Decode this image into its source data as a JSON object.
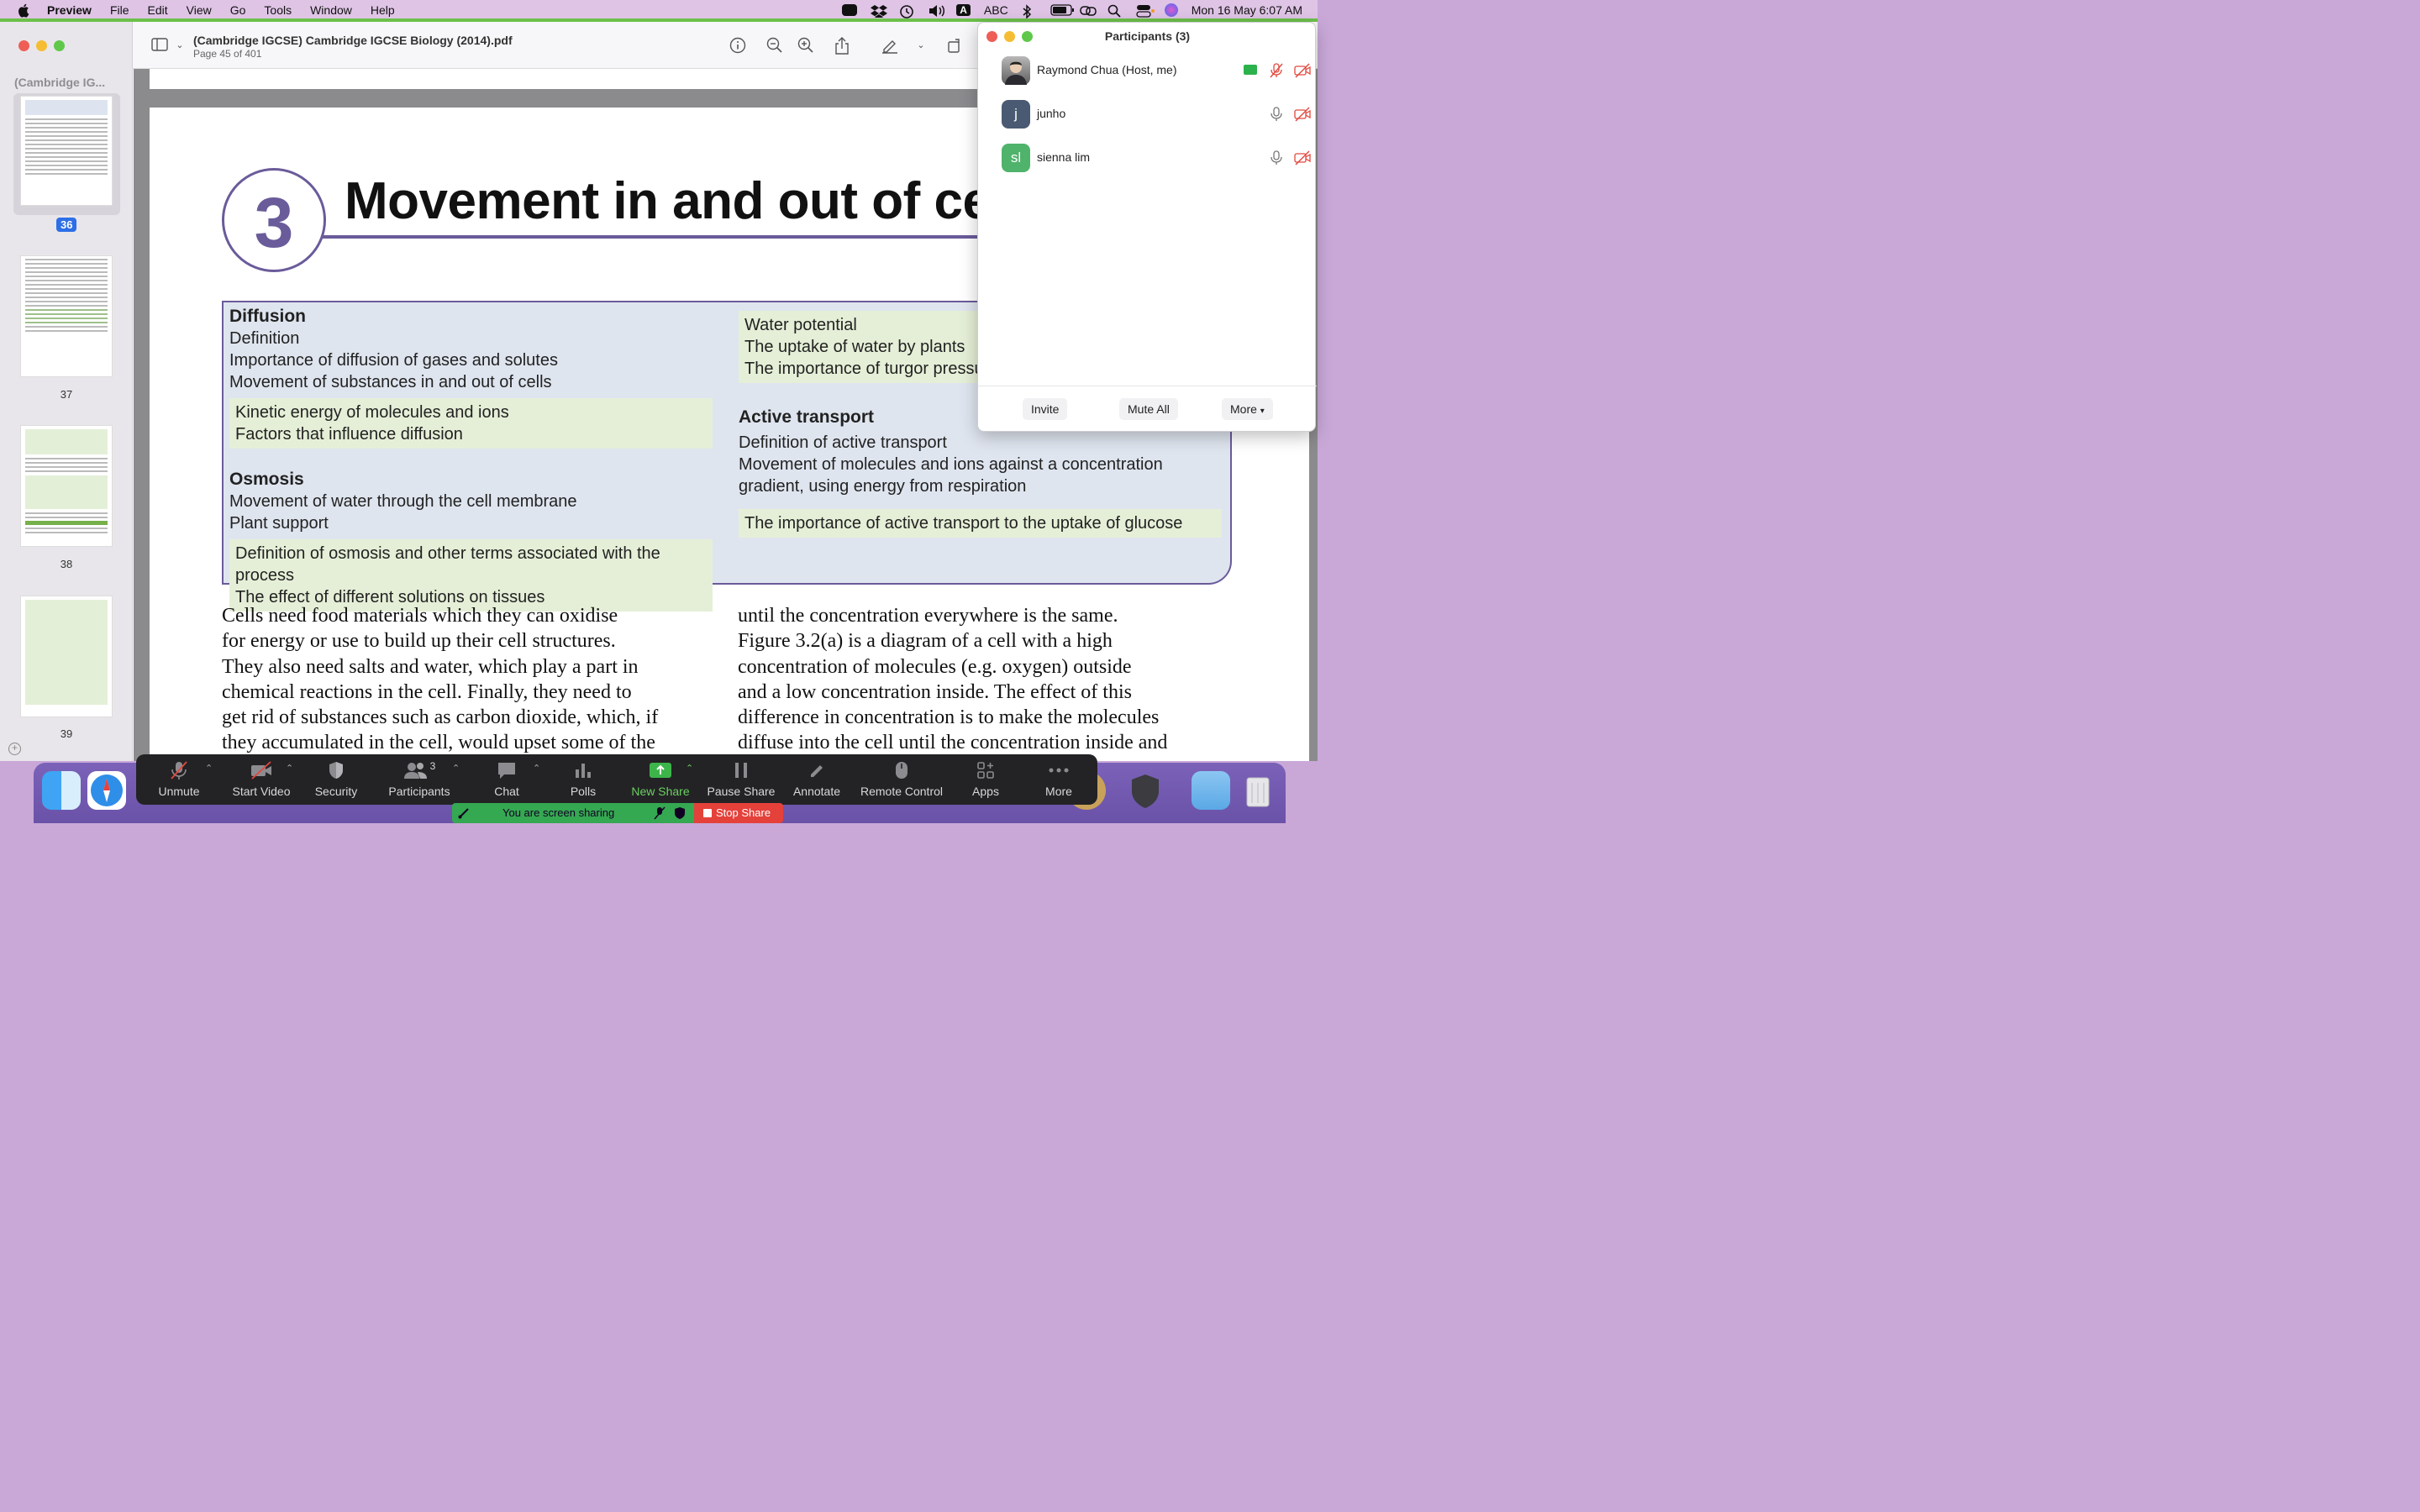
{
  "menubar": {
    "app": "Preview",
    "items": [
      "File",
      "Edit",
      "View",
      "Go",
      "Tools",
      "Window",
      "Help"
    ],
    "input_source": "ABC",
    "clock": "Mon 16 May  6:07 AM"
  },
  "preview": {
    "sidebar_title": "(Cambridge IG...",
    "thumbnails": [
      {
        "label": "36",
        "selected": true
      },
      {
        "label": "37",
        "selected": false
      },
      {
        "label": "38",
        "selected": false
      },
      {
        "label": "39",
        "selected": false
      }
    ],
    "document_title": "(Cambridge IGCSE) Cambridge IGCSE Biology (2014).pdf",
    "page_indicator": "Page 45 of 401"
  },
  "page": {
    "chapter_number": "3",
    "chapter_title": "Movement in and out of cells",
    "contents": {
      "left": {
        "diffusion_head": "Diffusion",
        "diffusion_items": [
          "Definition",
          "Importance of diffusion of gases and solutes",
          "Movement of substances in and out of cells"
        ],
        "diffusion_ext": [
          "Kinetic energy of molecules and ions",
          "Factors that influence diffusion"
        ],
        "osmosis_head": "Osmosis",
        "osmosis_items": [
          "Movement of water through the cell membrane",
          "Plant support"
        ],
        "osmosis_ext": [
          "Definition of osmosis and other terms associated with the process",
          "The effect of different solutions on tissues"
        ]
      },
      "right": {
        "osmosis_ext": [
          "Water potential",
          "The uptake of water by plants",
          "The importance of turgor pressure"
        ],
        "active_head": "Active transport",
        "active_items": [
          "Definition of active transport",
          "Movement of molecules and ions against a concentration",
          "gradient, using energy from respiration"
        ],
        "active_ext": [
          "The importance of active transport to the uptake of glucose"
        ]
      }
    },
    "body_left": [
      "Cells need food materials which they can oxidise",
      "for energy or use to build up their cell structures.",
      "They also need salts and water, which play a part in",
      "chemical reactions in the cell. Finally, they need to",
      "get rid of substances such as carbon dioxide, which, if",
      "they accumulated in the cell, would upset some of the"
    ],
    "body_right": [
      "until the concentration everywhere is the same.",
      "Figure 3.2(a) is a diagram of a cell with a high",
      "concentration of molecules (e.g. oxygen) outside",
      "and a low concentration inside. The effect of this",
      "difference in concentration is to make the molecules",
      "diffuse into the cell until the concentration inside and"
    ]
  },
  "participants": {
    "title": "Participants (3)",
    "list": [
      {
        "name": "Raymond Chua (Host, me)",
        "initials": "",
        "avatar_color": "#8a8a8a"
      },
      {
        "name": "junho",
        "initials": "j",
        "avatar_color": "#4a5a72"
      },
      {
        "name": "sienna lim",
        "initials": "sl",
        "avatar_color": "#4fb36b"
      }
    ],
    "buttons": {
      "invite": "Invite",
      "mute_all": "Mute All",
      "more": "More"
    }
  },
  "zoom_toolbar": {
    "unmute": "Unmute",
    "start_video": "Start Video",
    "security": "Security",
    "participants": "Participants",
    "participant_count": "3",
    "chat": "Chat",
    "polls": "Polls",
    "new_share": "New Share",
    "pause_share": "Pause Share",
    "annotate": "Annotate",
    "remote_control": "Remote Control",
    "apps": "Apps",
    "more": "More"
  },
  "share_status": {
    "text": "You are screen sharing",
    "stop": "Stop Share"
  },
  "colors": {
    "accent_purple": "#6a5b9a",
    "highlight_green": "#e5efd7",
    "zoom_green": "#6bd060",
    "stop_red": "#e4413a"
  }
}
